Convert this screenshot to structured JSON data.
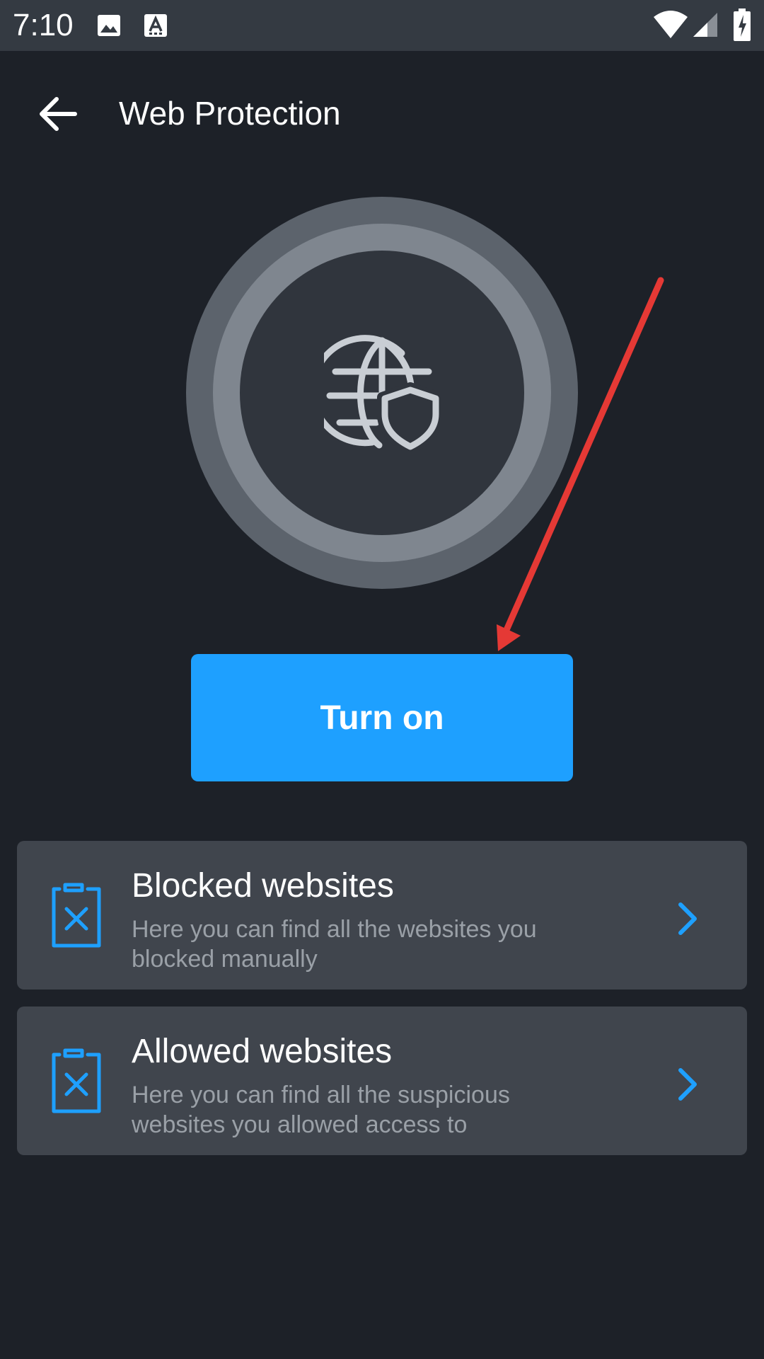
{
  "status_bar": {
    "time": "7:10",
    "left_icons": [
      "image-icon",
      "font-icon"
    ],
    "right_icons": [
      "wifi-icon",
      "signal-icon",
      "battery-charging-icon"
    ]
  },
  "app_bar": {
    "back_icon": "arrow-left-icon",
    "title": "Web Protection"
  },
  "hero": {
    "icon": "globe-shield-icon"
  },
  "primary_action": {
    "label": "Turn on",
    "color": "#1ea0ff"
  },
  "annotation": {
    "type": "arrow",
    "color": "#e53935"
  },
  "list": {
    "items": [
      {
        "title": "Blocked websites",
        "description": "Here you can find all the websites you blocked manually",
        "icon": "clipboard-x-icon",
        "chevron": "chevron-right-icon"
      },
      {
        "title": "Allowed websites",
        "description": "Here you can find all the suspicious websites you allowed access to",
        "icon": "clipboard-x-icon",
        "chevron": "chevron-right-icon"
      }
    ]
  },
  "colors": {
    "background": "#1d2128",
    "status_bar": "#343a42",
    "card": "#40454d",
    "accent": "#1ea0ff",
    "secondary_text": "#9aa0a7"
  }
}
